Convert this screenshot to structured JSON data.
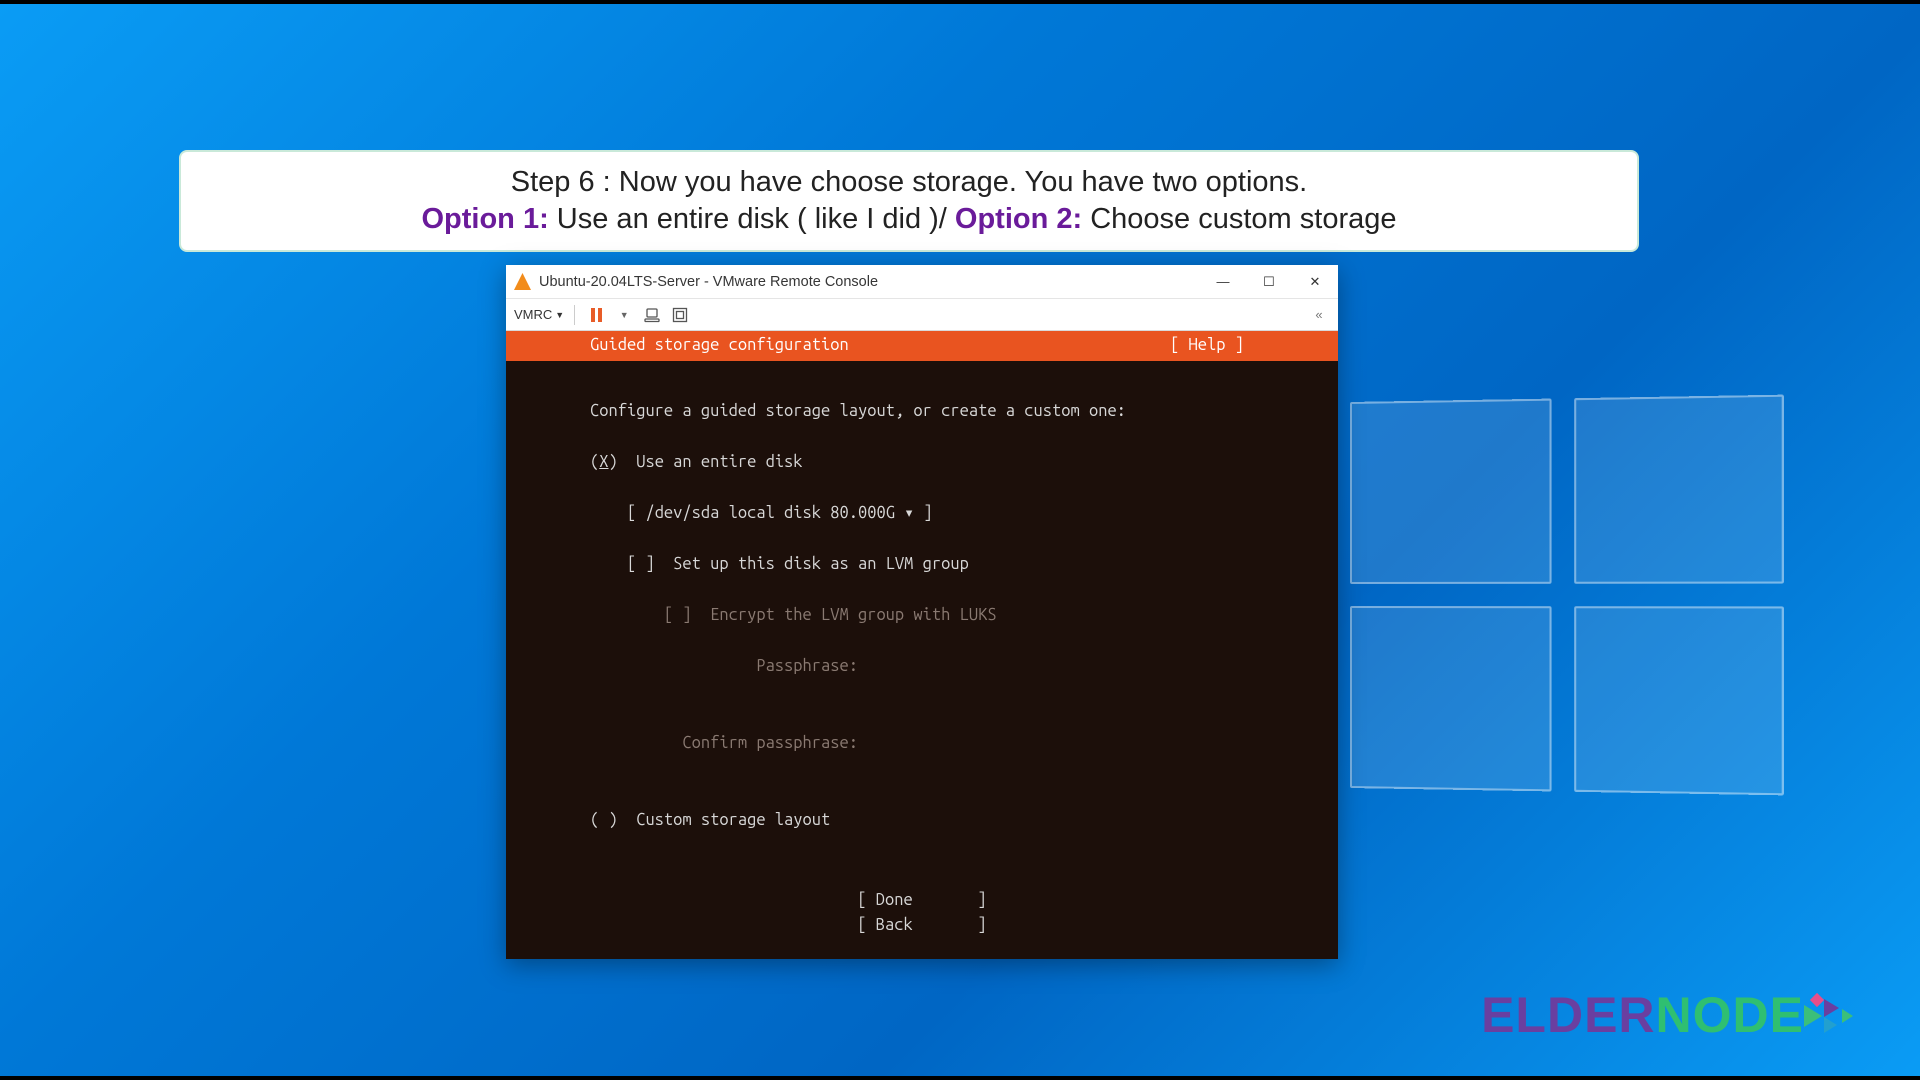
{
  "caption": {
    "line1": "Step 6 : Now you have choose storage. You have two options.",
    "opt1_label": "Option 1:",
    "opt1_text": " Use an entire disk ( like I did )/ ",
    "opt2_label": "Option 2:",
    "opt2_text": " Choose custom storage"
  },
  "vmware": {
    "title": "Ubuntu-20.04LTS-Server - VMware Remote Console",
    "menu_label": "VMRC",
    "win_min": "—",
    "win_max": "☐",
    "win_close": "✕",
    "fullscreen_hint": "«"
  },
  "installer": {
    "header_title": "Guided storage configuration",
    "header_help": "[ Help ]",
    "prompt": "Configure a guided storage layout, or create a custom one:",
    "opt_entire_prefix": "(",
    "opt_entire_x": "X",
    "opt_entire_suffix": ")  Use an entire disk",
    "disk_selector": "[ /dev/sda local disk 80.000G ▾ ]",
    "lvm_option": "[ ]  Set up this disk as an LVM group",
    "encrypt_option": "[ ]  Encrypt the LVM group with LUKS",
    "passphrase_label": "Passphrase:",
    "confirm_label": "Confirm passphrase:",
    "opt_custom": "( )  Custom storage layout",
    "btn_done": "[ Done       ]",
    "btn_back": "[ Back       ]"
  },
  "branding": {
    "elder": "ELDER",
    "node": "NODE"
  }
}
